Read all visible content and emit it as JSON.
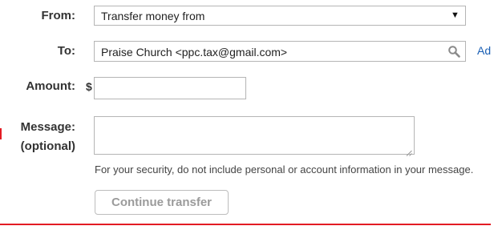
{
  "form": {
    "from": {
      "label": "From:",
      "value": "Transfer money from"
    },
    "to": {
      "label": "To:",
      "value": "Praise Church <ppc.tax@gmail.com>",
      "add_link": "Ad"
    },
    "amount": {
      "label": "Amount:",
      "currency": "$",
      "value": ""
    },
    "message": {
      "label_line1": "Message:",
      "label_line2": "(optional)",
      "value": ""
    },
    "security_note": "For your security, do not include personal or account information in your message.",
    "continue_button": "Continue transfer"
  },
  "icons": {
    "dropdown": "chevron-down-icon",
    "search": "search-icon",
    "resize": "resize-grip-icon"
  },
  "colors": {
    "accent": "#e31b23",
    "link": "#1a5fb4",
    "disabled_text": "#9b9b9b"
  }
}
